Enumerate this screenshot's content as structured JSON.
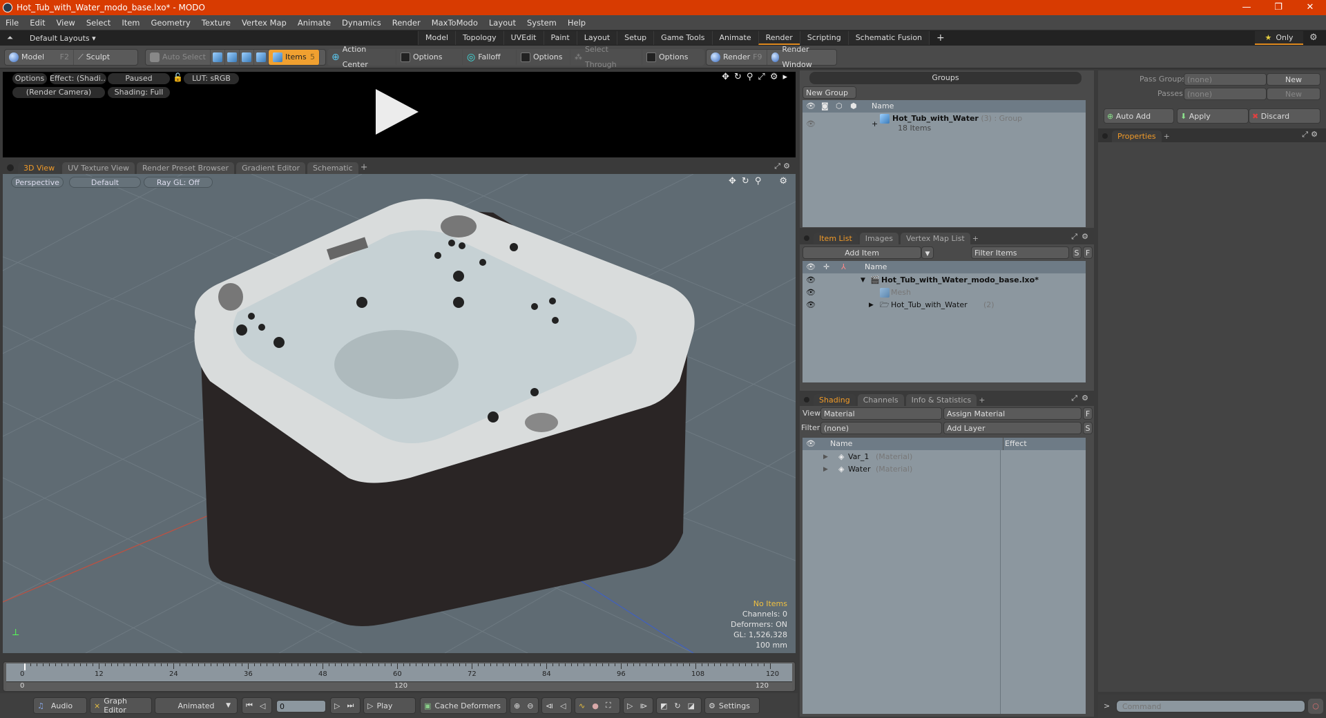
{
  "window": {
    "title": "Hot_Tub_with_Water_modo_base.lxo* - MODO",
    "controls": [
      "—",
      "❐",
      "✕"
    ]
  },
  "menu": [
    "File",
    "Edit",
    "View",
    "Select",
    "Item",
    "Geometry",
    "Texture",
    "Vertex Map",
    "Animate",
    "Dynamics",
    "Render",
    "MaxToModo",
    "Layout",
    "System",
    "Help"
  ],
  "layoutbar": {
    "layouts_label": "Default Layouts ▾",
    "tabs": [
      "Model",
      "Topology",
      "UVEdit",
      "Paint",
      "Layout",
      "Setup",
      "Game Tools",
      "Animate",
      "Render",
      "Scripting",
      "Schematic Fusion"
    ],
    "active_tab": "Render",
    "add": "+",
    "only_label": "Only"
  },
  "toolbar": {
    "model": "Model",
    "model_key": "F2",
    "sculpt": "Sculpt",
    "auto_select": "Auto Select",
    "items": "Items",
    "items_key": "5",
    "action_center": "Action Center",
    "options1": "Options",
    "falloff": "Falloff",
    "options2": "Options",
    "select_through": "Select Through",
    "options3": "Options",
    "render": "Render",
    "render_key": "F9",
    "render_window": "Render Window"
  },
  "render_preview": {
    "options": "Options",
    "effect": "Effect: (Shadi...",
    "paused": "Paused",
    "lut": "LUT: sRGB",
    "camera": "(Render Camera)",
    "shading": "Shading: Full"
  },
  "viewport_tabs": [
    "3D View",
    "UV Texture View",
    "Render Preset Browser",
    "Gradient Editor",
    "Schematic"
  ],
  "viewport": {
    "perspective": "Perspective",
    "default": "Default",
    "raygl": "Ray GL: Off",
    "stats": {
      "no_items": "No Items",
      "channels": "Channels: 0",
      "deformers": "Deformers: ON",
      "gl": "GL: 1,526,328",
      "scale": "100 mm"
    }
  },
  "timeline": {
    "ticks": [
      "0",
      "12",
      "24",
      "36",
      "48",
      "60",
      "72",
      "84",
      "96",
      "108",
      "120"
    ],
    "range_start": "0",
    "range_mid": "120",
    "range_end": "120",
    "range_end2": "120"
  },
  "transport": {
    "audio": "Audio",
    "graph_editor": "Graph Editor",
    "animated": "Animated",
    "frame": "0",
    "play": "Play",
    "cache_deformers": "Cache Deformers",
    "settings": "Settings"
  },
  "groups": {
    "title": "Groups",
    "new_group": "New Group",
    "col_name": "Name",
    "row": {
      "name": "Hot_Tub_with_Water",
      "count": "(3)",
      "type": ": Group",
      "sub": "18 Items"
    }
  },
  "passes": {
    "pass_groups_label": "Pass Groups",
    "pass_groups_value": "(none)",
    "new1": "New",
    "passes_label": "Passes",
    "passes_value": "(none)",
    "new2": "New",
    "auto_add": "Auto Add",
    "apply": "Apply",
    "discard": "Discard",
    "properties_tab": "Properties"
  },
  "itemlist": {
    "tabs": [
      "Item List",
      "Images",
      "Vertex Map List"
    ],
    "add_item": "Add Item",
    "filter": "Filter Items",
    "s": "S",
    "f": "F",
    "col_name": "Name",
    "rows": [
      {
        "name": "Hot_Tub_with_Water_modo_base.lxo*",
        "extra": ""
      },
      {
        "name": "Mesh",
        "extra": ""
      },
      {
        "name": "Hot_Tub_with_Water",
        "extra": "(2)"
      }
    ]
  },
  "shading": {
    "tabs": [
      "Shading",
      "Channels",
      "Info & Statistics"
    ],
    "view_label": "View",
    "view_value": "Material",
    "assign": "Assign Material",
    "f": "F",
    "filter_label": "Filter",
    "filter_value": "(none)",
    "add_layer": "Add Layer",
    "s": "S",
    "col_name": "Name",
    "col_effect": "Effect",
    "rows": [
      {
        "name": "Var_1",
        "type": "(Material)"
      },
      {
        "name": "Water",
        "type": "(Material)"
      }
    ]
  },
  "command": {
    "prompt": ">",
    "placeholder": "Command"
  }
}
